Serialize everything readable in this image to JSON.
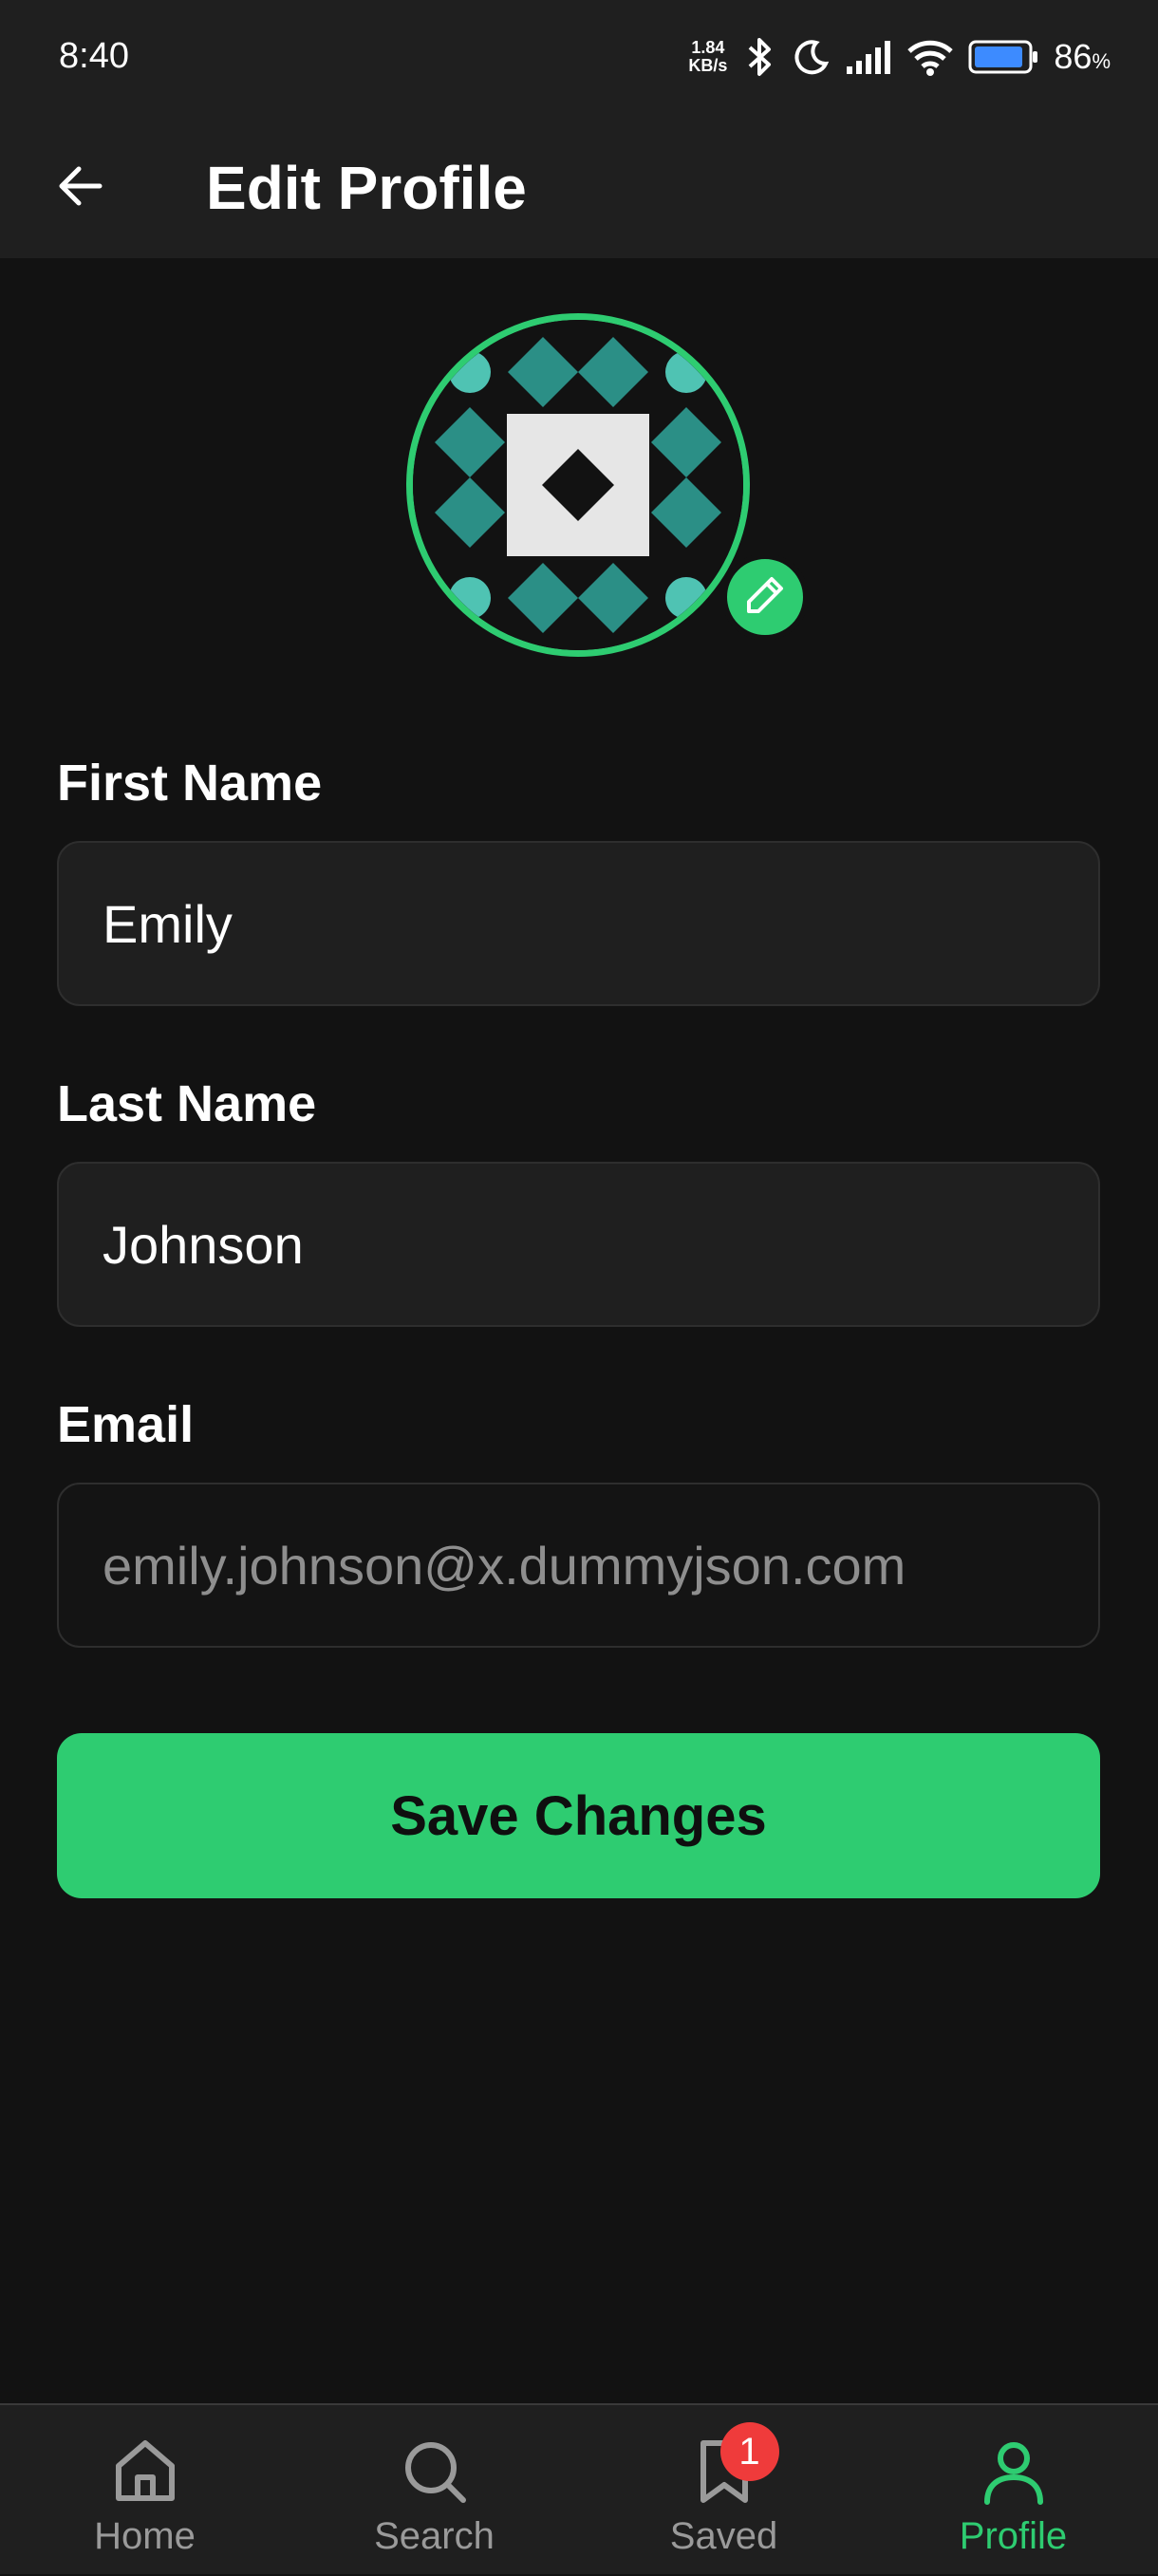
{
  "status_bar": {
    "time": "8:40",
    "net_speed_value": "1.84",
    "net_speed_unit": "KB/s",
    "battery_percent": "86",
    "battery_unit": "%",
    "icons": [
      "bluetooth-icon",
      "moon-icon",
      "signal-icon",
      "wifi-icon",
      "battery-icon"
    ]
  },
  "app_bar": {
    "title": "Edit Profile",
    "back_icon": "arrow-left-icon"
  },
  "avatar": {
    "ring_color": "#2ecc71",
    "edit_icon": "pencil-icon"
  },
  "form": {
    "first_name": {
      "label": "First Name",
      "value": "Emily"
    },
    "last_name": {
      "label": "Last Name",
      "value": "Johnson"
    },
    "email": {
      "label": "Email",
      "value": "emily.johnson@x.dummyjson.com"
    },
    "save_label": "Save Changes"
  },
  "bottom_nav": {
    "items": [
      {
        "label": "Home",
        "icon": "home-icon",
        "active": false
      },
      {
        "label": "Search",
        "icon": "search-icon",
        "active": false
      },
      {
        "label": "Saved",
        "icon": "bookmark-icon",
        "active": false,
        "badge": "1"
      },
      {
        "label": "Profile",
        "icon": "user-icon",
        "active": true
      }
    ]
  },
  "colors": {
    "accent": "#2ecc71",
    "background": "#121212",
    "surface": "#1f1f1f",
    "badge": "#ef3b3b"
  }
}
